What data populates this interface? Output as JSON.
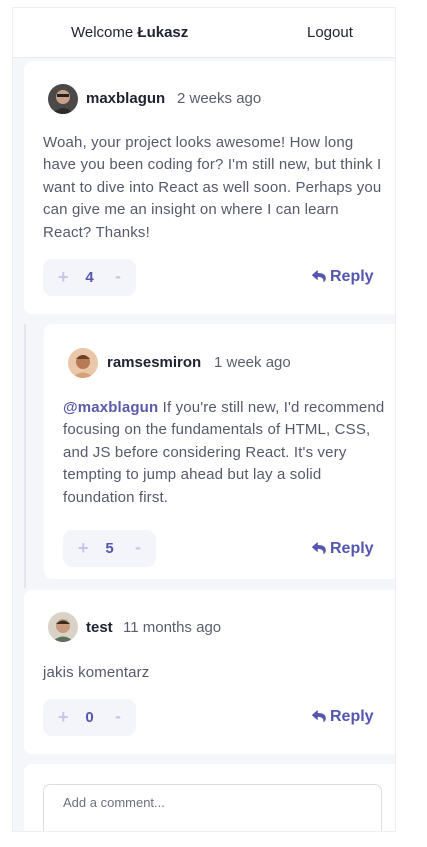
{
  "header": {
    "welcome_prefix": "Welcome",
    "username": "Łukasz",
    "logout_label": "Logout"
  },
  "comments": [
    {
      "username": "maxblagun",
      "time": "2 weeks ago",
      "text": "Woah, your project looks awesome! How long have you been coding for? I'm still new, but think I want to dive into React as well soon. Perhaps you can give me an insight on where I can learn React? Thanks!",
      "score": "4",
      "plus": "+",
      "minus": "-",
      "reply_label": "Reply"
    },
    {
      "username": "ramsesmiron",
      "time": "1 week ago",
      "mention": "@maxblagun",
      "text": "If you're still new, I'd recommend focusing on the fundamentals of HTML, CSS, and JS before considering React. It's very tempting to jump ahead but lay a solid foundation first.",
      "score": "5",
      "plus": "+",
      "minus": "-",
      "reply_label": "Reply"
    },
    {
      "username": "test",
      "time": "11 months ago",
      "text": "jakis komentarz",
      "score": "0",
      "plus": "+",
      "minus": "-",
      "reply_label": "Reply"
    }
  ],
  "new_comment": {
    "placeholder": "Add a comment..."
  },
  "colors": {
    "accent": "#5457b0",
    "vote_inactive": "#c5c6ec",
    "background": "#f5f6fa"
  },
  "icons": {
    "reply": "reply-arrow-icon"
  }
}
